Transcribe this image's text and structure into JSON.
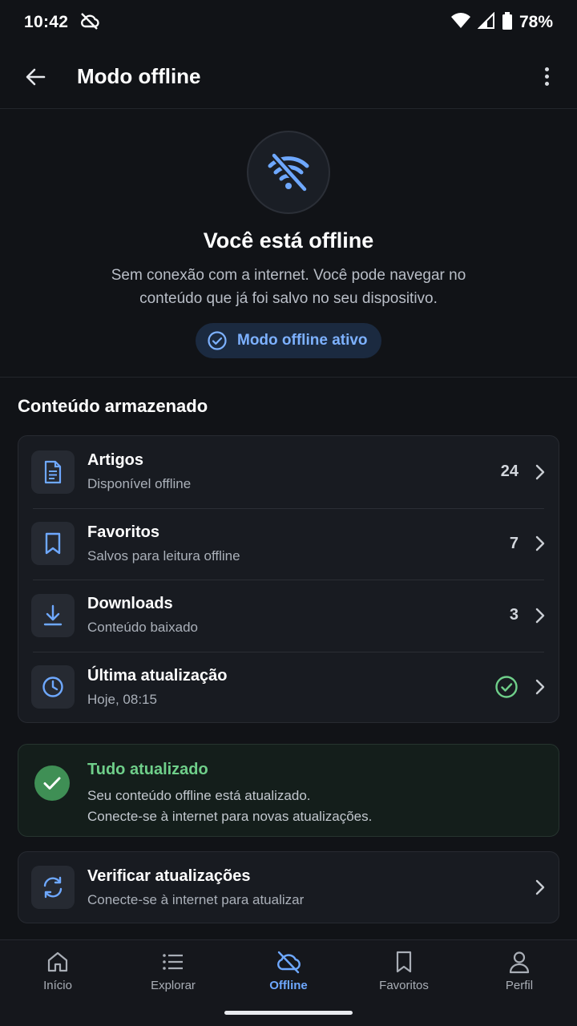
{
  "status_bar": {
    "time": "10:42",
    "battery": "78%",
    "icons": [
      "cloud-off-icon",
      "wifi-icon",
      "signal-icon",
      "battery-icon"
    ]
  },
  "app_bar": {
    "title": "Modo offline",
    "icons": [
      "arrow-back-icon",
      "more-vert-icon"
    ]
  },
  "hero": {
    "title": "Você está offline",
    "description": "Sem conexão com a internet. Você pode navegar no conteúdo que já foi salvo no seu dispositivo.",
    "badge": "Modo offline ativo",
    "icon": "wifi-off-icon"
  },
  "storage": {
    "section_title": "Conteúdo armazenado",
    "items": [
      {
        "title": "Artigos",
        "subtitle": "Disponível offline",
        "count": "24",
        "icon": "article-icon"
      },
      {
        "title": "Favoritos",
        "subtitle": "Salvos para leitura offline",
        "count": "7",
        "icon": "bookmark-icon"
      },
      {
        "title": "Downloads",
        "subtitle": "Conteúdo baixado",
        "count": "3",
        "icon": "download-icon"
      },
      {
        "title": "Última atualização",
        "subtitle": "Hoje, 08:15",
        "count": "",
        "icon": "clock-icon"
      }
    ]
  },
  "updated": {
    "title": "Tudo atualizado",
    "line1": "Seu conteúdo offline está atualizado.",
    "line2": "Conecte-se à internet para novas atualizações."
  },
  "check_updates": {
    "title": "Verificar atualizações",
    "subtitle": "Conecte-se à internet para atualizar"
  },
  "bottom_nav": {
    "items": [
      {
        "label": "Início",
        "icon": "home-icon",
        "active": false
      },
      {
        "label": "Explorar",
        "icon": "list-icon",
        "active": false
      },
      {
        "label": "Offline",
        "icon": "cloud-off-icon",
        "active": true
      },
      {
        "label": "Favoritos",
        "icon": "bookmark-icon",
        "active": false
      },
      {
        "label": "Perfil",
        "icon": "person-icon",
        "active": false
      }
    ]
  },
  "colors": {
    "background": "#111317",
    "accent": "#6ea8ff",
    "success": "#6fcf8a"
  }
}
